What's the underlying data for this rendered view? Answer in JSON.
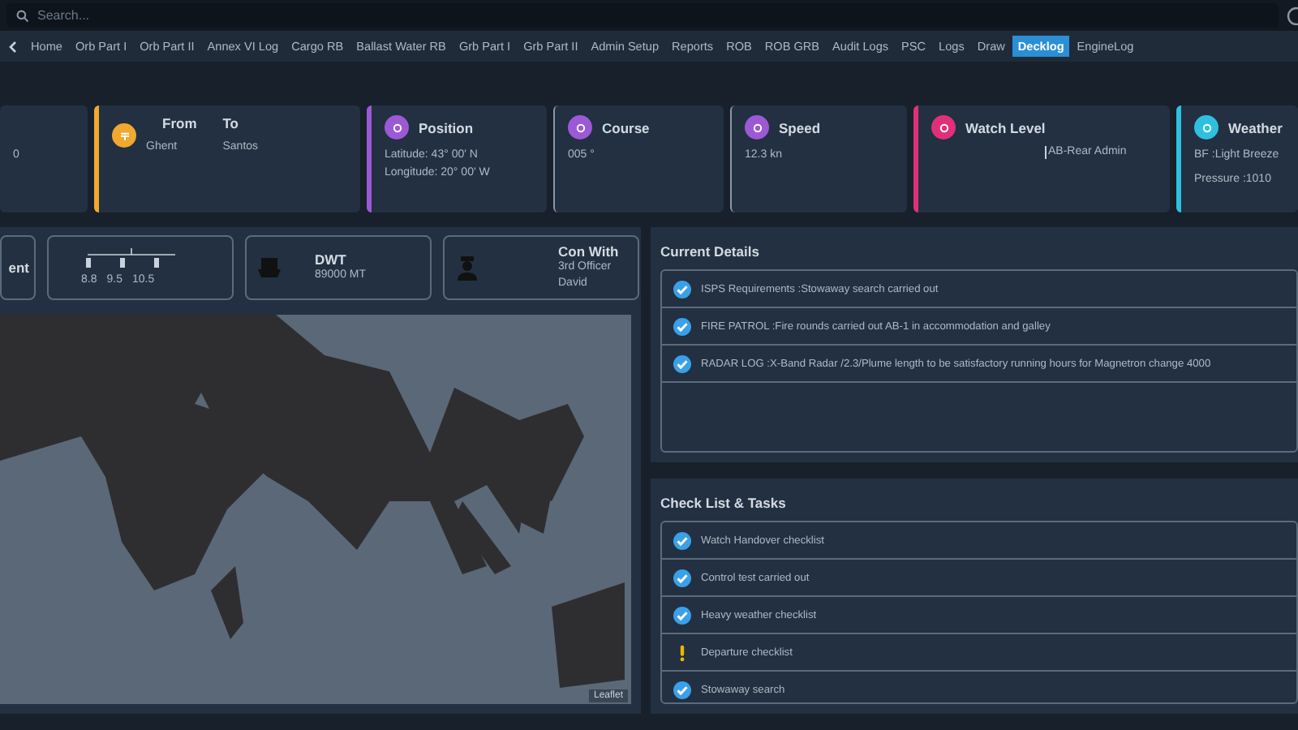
{
  "search": {
    "placeholder": "Search..."
  },
  "nav": {
    "items": [
      {
        "label": "Home",
        "selected": false
      },
      {
        "label": "Orb Part I",
        "selected": false
      },
      {
        "label": "Orb Part II",
        "selected": false
      },
      {
        "label": "Annex VI Log",
        "selected": false
      },
      {
        "label": "Cargo RB",
        "selected": false
      },
      {
        "label": "Ballast Water RB",
        "selected": false
      },
      {
        "label": "Grb Part I",
        "selected": false
      },
      {
        "label": "Grb Part II",
        "selected": false
      },
      {
        "label": "Admin Setup",
        "selected": false
      },
      {
        "label": "Reports",
        "selected": false
      },
      {
        "label": "ROB",
        "selected": false
      },
      {
        "label": "ROB GRB",
        "selected": false
      },
      {
        "label": "Audit Logs",
        "selected": false
      },
      {
        "label": "PSC",
        "selected": false
      },
      {
        "label": "Logs",
        "selected": false
      },
      {
        "label": "Draw",
        "selected": false
      },
      {
        "label": "Decklog",
        "selected": true
      },
      {
        "label": "EngineLog",
        "selected": false
      }
    ]
  },
  "summary_cards": [
    {
      "kind": "partial",
      "lines": [
        "0"
      ]
    },
    {
      "kind": "route",
      "color": "#f0a830",
      "accent": true,
      "labels": [
        "From",
        "To"
      ],
      "values": [
        "Ghent",
        "Santos"
      ]
    },
    {
      "kind": "text",
      "title": "Position",
      "color": "#9b59d6",
      "accent": true,
      "lines": [
        "Latitude: 43° 00' N Longitude: 20° 00' W"
      ]
    },
    {
      "kind": "text",
      "title": "Course",
      "color": "#9b59d6",
      "accent": false,
      "lines": [
        "005 °"
      ]
    },
    {
      "kind": "text",
      "title": "Speed",
      "color": "#9b59d6",
      "accent": false,
      "lines": [
        "12.3 kn"
      ]
    },
    {
      "kind": "field",
      "title": "Watch Level",
      "color": "#e0307a",
      "accent": true,
      "lines": [
        "AB-Rear Admin"
      ]
    },
    {
      "kind": "text",
      "title": "Weather",
      "color": "#2fc0e0",
      "accent": true,
      "lines": [
        "BF :Light Breeze",
        "Pressure :1010"
      ]
    }
  ],
  "vessel_cards": [
    {
      "kind": "partial",
      "title": "ent"
    },
    {
      "kind": "draft",
      "readings": [
        "8.8",
        "9.5",
        "10.5"
      ]
    },
    {
      "kind": "dwt",
      "title": "DWT",
      "lines": [
        "89000 MT"
      ]
    },
    {
      "kind": "officer",
      "title": "Con With",
      "lines": [
        "3rd Officer",
        "David"
      ]
    }
  ],
  "map": {
    "attribution": "Leaflet"
  },
  "current_details": {
    "title": "Current Details",
    "items": [
      {
        "text": "ISPS Requirements :Stowaway search carried out",
        "done": true
      },
      {
        "text": "FIRE PATROL :Fire rounds carried out AB-1 in accommodation and galley",
        "done": true
      },
      {
        "text": "RADAR LOG :X-Band Radar /2.3/Plume length to be satisfactory running hours for Magnetron change 4000",
        "done": true
      }
    ]
  },
  "checklist": {
    "title": "Check List & Tasks",
    "items": [
      {
        "text": "Watch Handover checklist",
        "done": true
      },
      {
        "text": "Control test carried out",
        "done": true
      },
      {
        "text": "Heavy weather checklist",
        "done": true
      },
      {
        "text": "Departure checklist",
        "done": false
      },
      {
        "text": "Stowaway search",
        "done": true
      }
    ]
  }
}
